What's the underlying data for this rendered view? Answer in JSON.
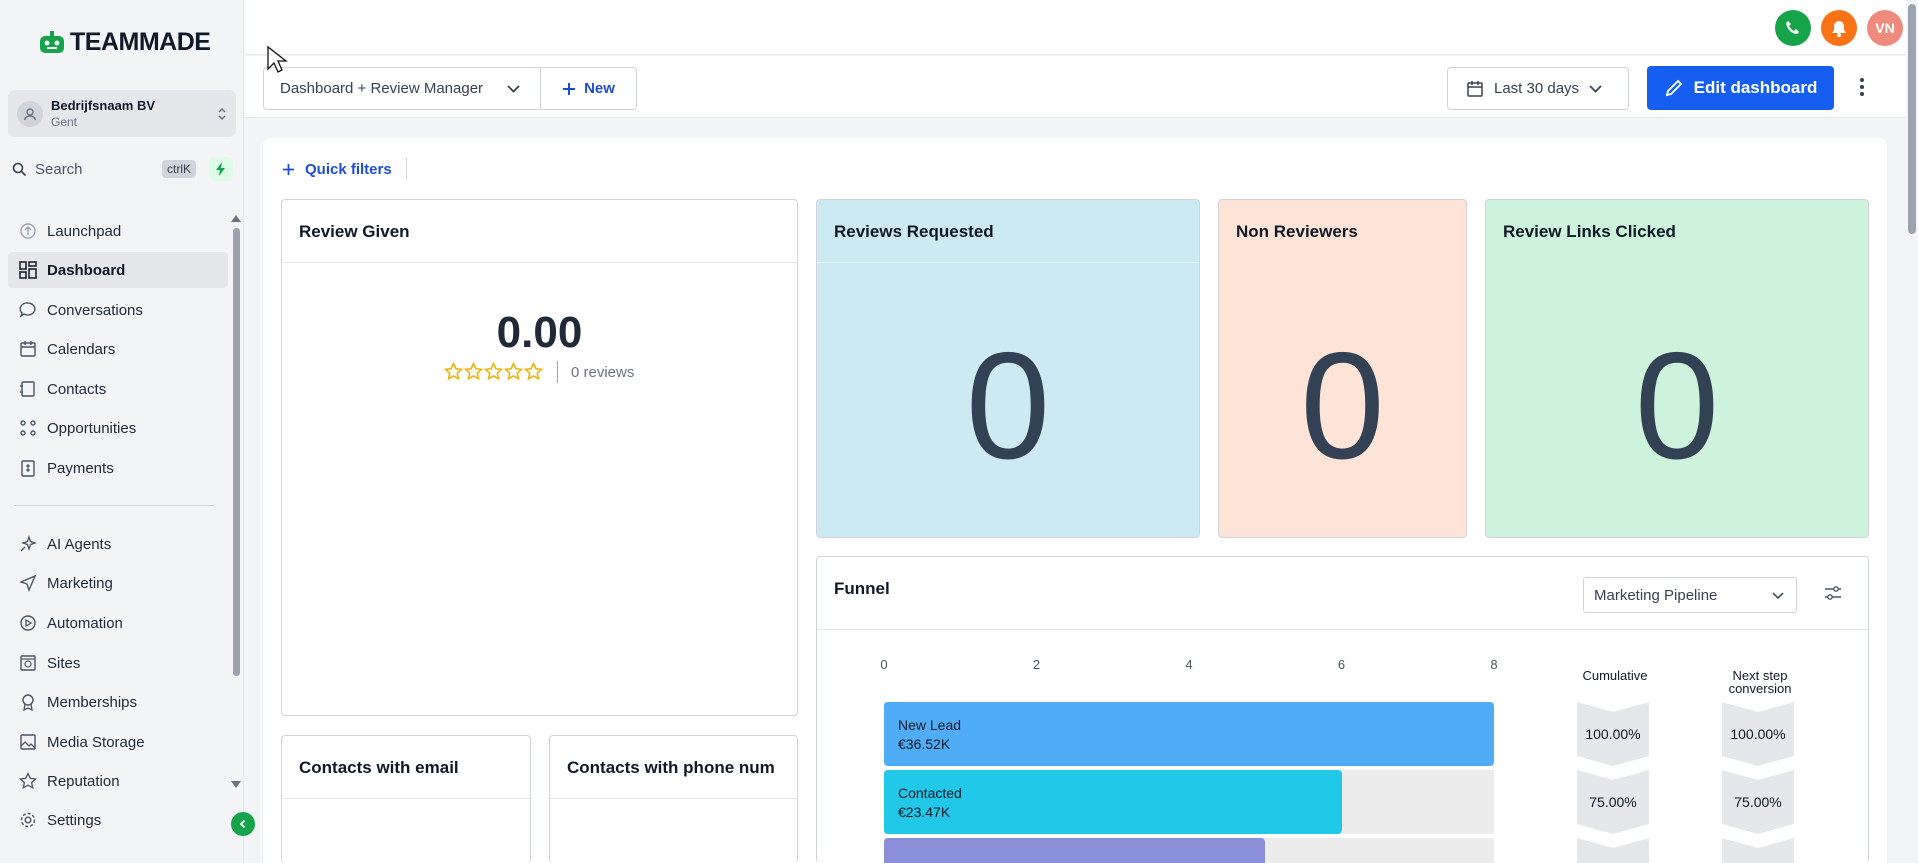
{
  "brand": {
    "logo_text": "TEAMMADE"
  },
  "account": {
    "name": "Bedrijfsnaam BV",
    "city": "Gent"
  },
  "search": {
    "placeholder": "Search",
    "shortcut": "ctrlK"
  },
  "nav": {
    "items": [
      {
        "label": "Launchpad",
        "icon": "launchpad-icon"
      },
      {
        "label": "Dashboard",
        "icon": "grid-icon",
        "active": true
      },
      {
        "label": "Conversations",
        "icon": "chat-icon"
      },
      {
        "label": "Calendars",
        "icon": "calendar-icon"
      },
      {
        "label": "Contacts",
        "icon": "contacts-icon"
      },
      {
        "label": "Opportunities",
        "icon": "opportunities-icon"
      },
      {
        "label": "Payments",
        "icon": "payments-icon"
      },
      {
        "label": "AI Agents",
        "icon": "sparkle-icon"
      },
      {
        "label": "Marketing",
        "icon": "send-icon"
      },
      {
        "label": "Automation",
        "icon": "automation-icon"
      },
      {
        "label": "Sites",
        "icon": "sites-icon"
      },
      {
        "label": "Memberships",
        "icon": "badge-icon"
      },
      {
        "label": "Media Storage",
        "icon": "image-icon"
      },
      {
        "label": "Reputation",
        "icon": "star-icon"
      },
      {
        "label": "Settings",
        "icon": "gear-icon"
      }
    ]
  },
  "topbar": {
    "avatar_initials": "VN"
  },
  "toolbar": {
    "dashboard_select": "Dashboard + Review Manager",
    "new_label": "New",
    "date_range": "Last 30 days",
    "edit_label": "Edit dashboard"
  },
  "filters": {
    "quick_filters_label": "Quick filters"
  },
  "widgets": {
    "review_given": {
      "title": "Review Given",
      "rating": "0.00",
      "reviews_text": "0 reviews"
    },
    "reviews_requested": {
      "title": "Reviews Requested",
      "value": "0",
      "bg": "#cdeaf3"
    },
    "non_reviewers": {
      "title": "Non Reviewers",
      "value": "0",
      "bg": "#fde4d6"
    },
    "review_links_clicked": {
      "title": "Review Links Clicked",
      "value": "0",
      "bg": "#cdf3dd"
    },
    "contacts_email": {
      "title": "Contacts with email"
    },
    "contacts_phone": {
      "title": "Contacts with phone num"
    }
  },
  "funnel": {
    "title": "Funnel",
    "pipeline": "Marketing Pipeline",
    "cumulative_label": "Cumulative",
    "next_step_label_1": "Next step",
    "next_step_label_2": "conversion",
    "chart_data": {
      "type": "bar",
      "orientation": "horizontal",
      "x_ticks": [
        "0",
        "2",
        "4",
        "6",
        "8"
      ],
      "xlim": [
        0,
        8
      ],
      "stages": [
        {
          "name": "New Lead",
          "amount": "€36.52K",
          "value": 8,
          "cumulative": "100.00%",
          "next_step": "100.00%",
          "color": "#4fadf8"
        },
        {
          "name": "Contacted",
          "amount": "€23.47K",
          "value": 6,
          "cumulative": "75.00%",
          "next_step": "75.00%",
          "color": "#22c8e8"
        },
        {
          "name": "",
          "amount": "",
          "value": 5,
          "cumulative": "",
          "next_step": "",
          "color": "#8b8ed8"
        }
      ]
    }
  }
}
